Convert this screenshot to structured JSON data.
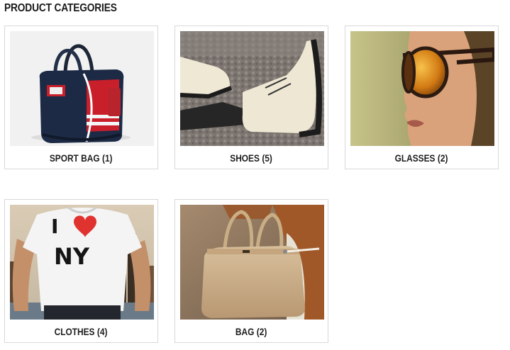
{
  "section_title": "PRODUCT CATEGORIES",
  "categories": [
    {
      "name": "SPORT BAG",
      "count": "(1)",
      "image": "sport-bag-photo"
    },
    {
      "name": "SHOES",
      "count": "(5)",
      "image": "shoes-photo"
    },
    {
      "name": "GLASSES",
      "count": "(2)",
      "image": "sunglasses-photo"
    },
    {
      "name": "CLOTHES",
      "count": "(4)",
      "image": "i-love-ny-tshirt-photo"
    },
    {
      "name": "BAG",
      "count": "(2)",
      "image": "handbag-photo"
    }
  ],
  "tshirt_print": {
    "top": "I",
    "bottom": "NY"
  },
  "colors": {
    "border": "#d8d8d8",
    "caption_text": "#1e1e1e"
  }
}
